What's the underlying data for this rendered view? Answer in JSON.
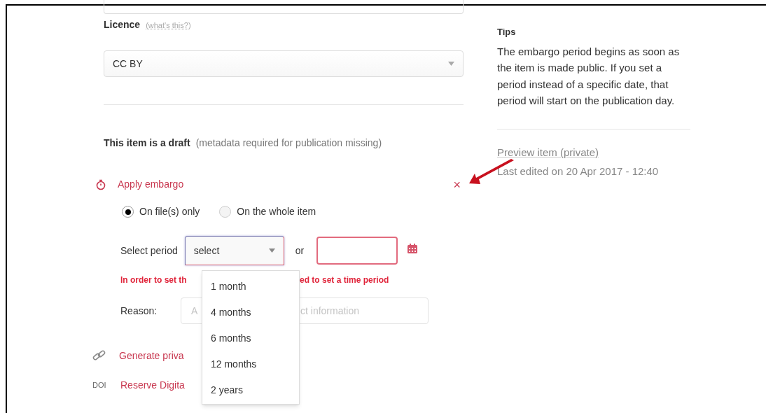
{
  "licence": {
    "label": "Licence",
    "help_link": "(what's this?)",
    "value": "CC BY"
  },
  "draft": {
    "title": "This item is a draft",
    "note": "(metadata required for publication missing)"
  },
  "embargo": {
    "title": "Apply embargo",
    "close": "×",
    "scope_options": [
      {
        "label": "On file(s) only",
        "selected": true
      },
      {
        "label": "On the whole item",
        "selected": false
      }
    ],
    "period_label": "Select period",
    "period_select": {
      "value": "select",
      "expanded": true,
      "invalid": true
    },
    "or": "or",
    "date_field": {
      "invalid": true
    },
    "error_parts": [
      "In order to set th",
      "ed to set a time period"
    ],
    "reason_label": "Reason:",
    "reason_placeholder_parts": [
      "A",
      "ct information"
    ],
    "period_options": [
      "1 month",
      "4 months",
      "6 months",
      "12 months",
      "2 years"
    ]
  },
  "actions": [
    {
      "kind": "link",
      "label": "Generate priva"
    },
    {
      "kind": "doi",
      "badge": "DOI",
      "label": "Reserve Digita"
    }
  ],
  "tips": {
    "title": "Tips",
    "text": "The embargo period begins as soon as the item is made public. If you set a period instead of a specific date, that period will start on the publication day."
  },
  "preview_link": "Preview item (private)",
  "last_edited": "Last edited on 20 Apr 2017 - 12:40"
}
